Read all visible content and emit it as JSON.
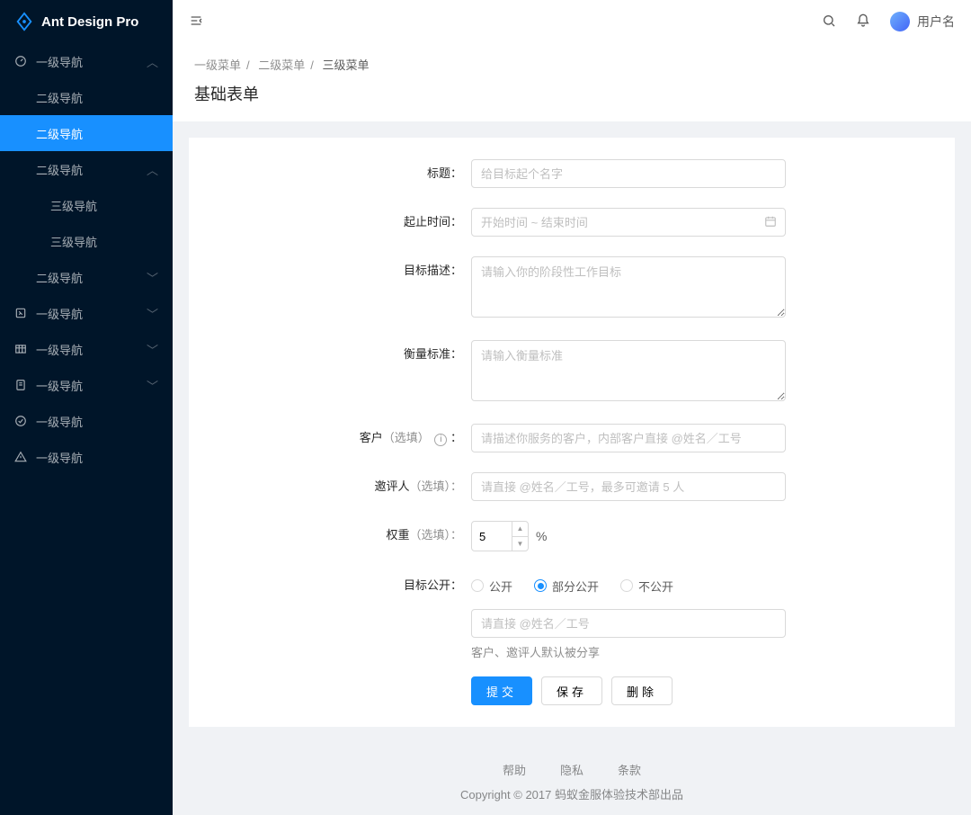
{
  "brand": "Ant Design Pro",
  "user": {
    "name": "用户名"
  },
  "sidebar": {
    "items": [
      {
        "label": "一级导航",
        "open": true
      },
      {
        "label": "二级导航"
      },
      {
        "label": "二级导航",
        "selected": true
      },
      {
        "label": "二级导航",
        "open": true
      },
      {
        "label": "三级导航"
      },
      {
        "label": "三级导航"
      },
      {
        "label": "二级导航",
        "collapsed": true
      },
      {
        "label": "一级导航",
        "collapsed": true
      },
      {
        "label": "一级导航",
        "collapsed": true
      },
      {
        "label": "一级导航",
        "collapsed": true
      },
      {
        "label": "一级导航"
      },
      {
        "label": "一级导航"
      }
    ]
  },
  "breadcrumb": {
    "a": "一级菜单",
    "b": "二级菜单",
    "c": "三级菜单"
  },
  "page": {
    "title": "基础表单"
  },
  "form": {
    "title_label": "标题：",
    "title_placeholder": "给目标起个名字",
    "date_label": "起止时间：",
    "date_placeholder": "开始时间 ~ 结束时间",
    "desc_label": "目标描述：",
    "desc_placeholder": "请输入你的阶段性工作目标",
    "metric_label": "衡量标准：",
    "metric_placeholder": "请输入衡量标准",
    "customer_label": "客户",
    "customer_optional": "（选填）",
    "customer_placeholder": "请描述你服务的客户，内部客户直接 @姓名／工号",
    "reviewer_label": "邀评人",
    "reviewer_optional": "（选填）：",
    "reviewer_placeholder": "请直接 @姓名／工号，最多可邀请 5 人",
    "weight_label": "权重",
    "weight_optional": "（选填）：",
    "weight_value": "5",
    "weight_suffix": "%",
    "public_label": "目标公开：",
    "public_options": {
      "a": "公开",
      "b": "部分公开",
      "c": "不公开"
    },
    "public_share_placeholder": "请直接 @姓名／工号",
    "public_help": "客户、邀评人默认被分享",
    "submit": "提交",
    "save": "保存",
    "delete": "删除"
  },
  "footer": {
    "links": {
      "a": "帮助",
      "b": "隐私",
      "c": "条款"
    },
    "copyright": "Copyright © 2017 蚂蚁金服体验技术部出品"
  }
}
